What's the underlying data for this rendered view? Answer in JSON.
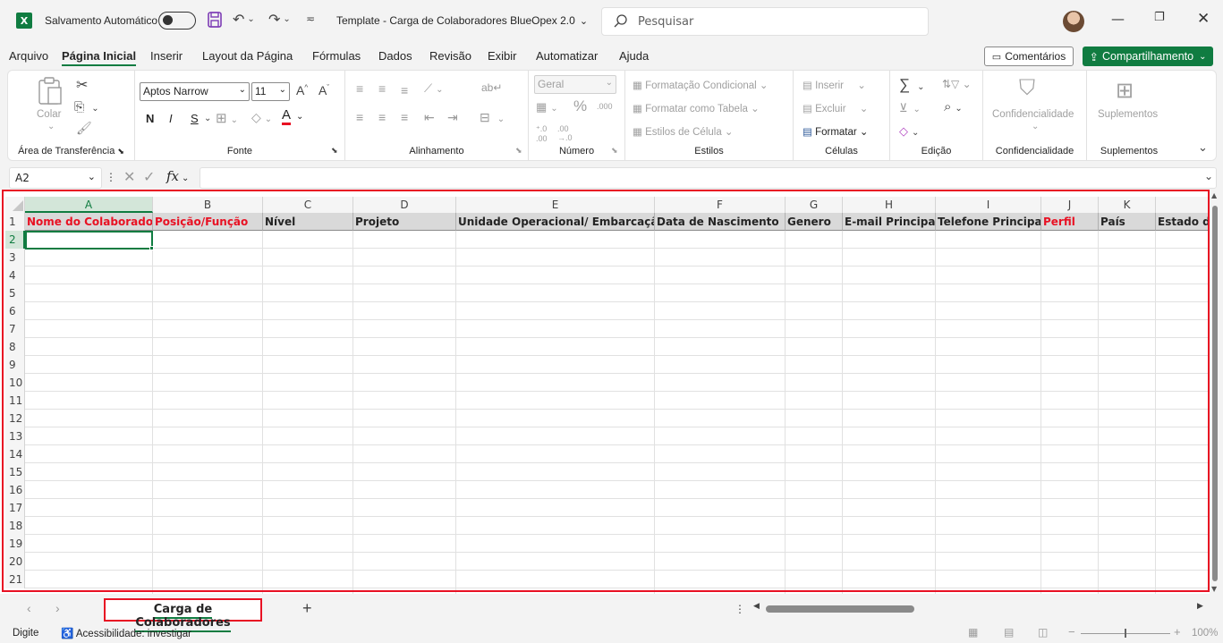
{
  "titlebar": {
    "app_icon": "X",
    "autosave_label": "Salvamento Automático",
    "file_title": "Template - Carga de Colaboradores BlueOpex 2.0",
    "search_placeholder": "Pesquisar"
  },
  "menu": {
    "items": [
      "Arquivo",
      "Página Inicial",
      "Inserir",
      "Layout da Página",
      "Fórmulas",
      "Dados",
      "Revisão",
      "Exibir",
      "Automatizar",
      "Ajuda"
    ],
    "active": "Página Inicial",
    "comments_label": "Comentários",
    "share_label": "Compartilhamento"
  },
  "ribbon": {
    "clipboard": {
      "paste_label": "Colar",
      "group_label": "Área de Transferência"
    },
    "font": {
      "font_name": "Aptos Narrow",
      "font_size": "11",
      "bold": "N",
      "italic": "I",
      "underline": "S",
      "group_label": "Fonte"
    },
    "alignment": {
      "group_label": "Alinhamento"
    },
    "number": {
      "format": "Geral",
      "group_label": "Número"
    },
    "styles": {
      "conditional": "Formatação Condicional",
      "as_table": "Formatar como Tabela",
      "cell_styles": "Estilos de Célula",
      "group_label": "Estilos"
    },
    "cells": {
      "insert": "Inserir",
      "delete": "Excluir",
      "format": "Formatar",
      "group_label": "Células"
    },
    "editing": {
      "group_label": "Edição"
    },
    "sensitivity": {
      "label": "Confidencialidade",
      "group_label": "Confidencialidade"
    },
    "addins": {
      "label": "Suplementos",
      "group_label": "Suplementos"
    }
  },
  "formula_bar": {
    "name_box": "A2",
    "formula": ""
  },
  "sheet": {
    "columns": [
      "A",
      "B",
      "C",
      "D",
      "E",
      "F",
      "G",
      "H",
      "I",
      "J",
      "K",
      ""
    ],
    "headers": [
      {
        "text": "Nome do Colaborador",
        "red": true
      },
      {
        "text": "Posição/Função",
        "red": true
      },
      {
        "text": "Nível",
        "red": false
      },
      {
        "text": "Projeto",
        "red": false
      },
      {
        "text": "Unidade Operacional/ Embarcação",
        "red": false
      },
      {
        "text": "Data de Nascimento",
        "red": false
      },
      {
        "text": "Genero",
        "red": false
      },
      {
        "text": "E-mail Principal",
        "red": false
      },
      {
        "text": "Telefone Principal",
        "red": false
      },
      {
        "text": "Perfil",
        "red": true
      },
      {
        "text": "País",
        "red": false
      },
      {
        "text": "Estado d",
        "red": false
      }
    ],
    "rows": [
      "1",
      "2",
      "3",
      "4",
      "5",
      "6",
      "7",
      "8",
      "9",
      "10",
      "11",
      "12",
      "13",
      "14",
      "15",
      "16",
      "17",
      "18",
      "19",
      "20",
      "21"
    ],
    "selected_cell": "A2"
  },
  "tabs": {
    "sheet_name": "Carga de Colaboradores",
    "add_label": "+"
  },
  "status": {
    "mode": "Digite",
    "accessibility": "Acessibilidade: investigar",
    "zoom": "100%"
  },
  "colors": {
    "excel_green": "#107c41",
    "highlight_red": "#e81123"
  }
}
